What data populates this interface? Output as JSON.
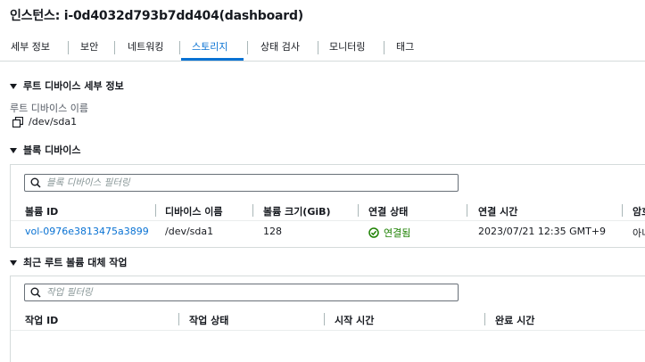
{
  "page": {
    "title": "인스턴스: i-0d4032d793b7dd404(dashboard)"
  },
  "tabs": [
    {
      "label": "세부 정보"
    },
    {
      "label": "보안"
    },
    {
      "label": "네트워킹"
    },
    {
      "label": "스토리지"
    },
    {
      "label": "상태 검사"
    },
    {
      "label": "모니터링"
    },
    {
      "label": "태그"
    }
  ],
  "active_tab": "스토리지",
  "root_device": {
    "section_title": "루트 디바이스 세부 정보",
    "name_label": "루트 디바이스 이름",
    "name_value": "/dev/sda1"
  },
  "block_devices": {
    "section_title": "블록 디바이스",
    "search_placeholder": "블록 디바이스 필터링",
    "columns": [
      "볼륨 ID",
      "디바이스 이름",
      "볼륨 크기(GiB)",
      "연결 상태",
      "연결 시간",
      "암호"
    ],
    "rows": [
      {
        "volume_id": "vol-0976e3813475a3899",
        "device_name": "/dev/sda1",
        "size": "128",
        "status": "연결됨",
        "attach_time": "2023/07/21 12:35 GMT+9",
        "encrypted": "아니"
      }
    ]
  },
  "replace_tasks": {
    "section_title": "최근 루트 볼륨 대체 작업",
    "search_placeholder": "작업 필터링",
    "columns": [
      "작업 ID",
      "작업 상태",
      "시작 시간",
      "완료 시간"
    ]
  },
  "colors": {
    "accent": "#0972d3",
    "success": "#1d8102",
    "border": "#d5dbdb",
    "text": "#16191f"
  }
}
